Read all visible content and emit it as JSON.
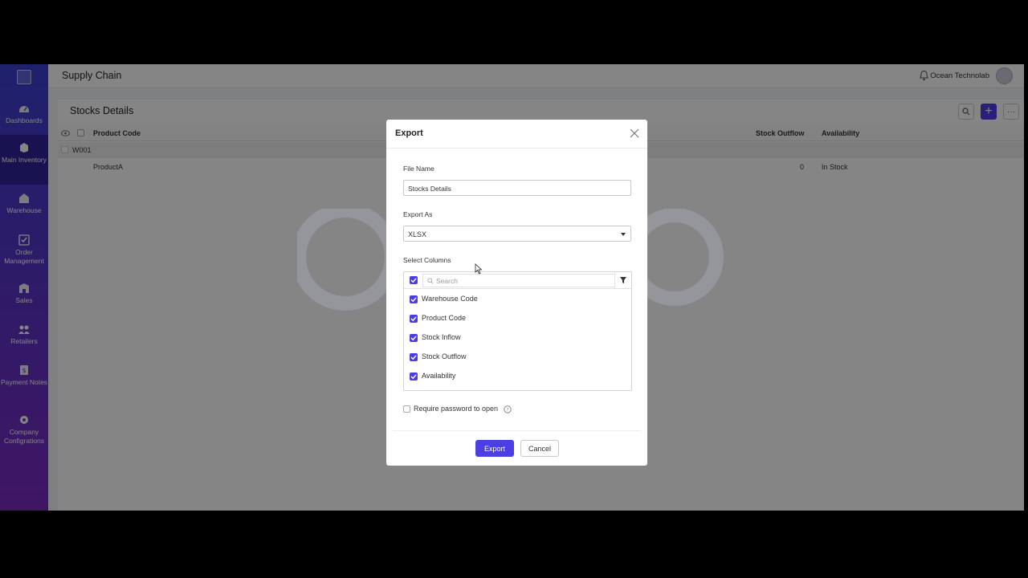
{
  "app": {
    "title": "Supply Chain",
    "org": "Ocean Technolab"
  },
  "sidebar": {
    "items": [
      {
        "label": "Dashboards",
        "icon": "dashboard-icon"
      },
      {
        "label": "Main Inventory",
        "icon": "inventory-box-icon",
        "active": true
      },
      {
        "label": "Warehouse",
        "icon": "warehouse-icon"
      },
      {
        "label": "Order Management",
        "icon": "order-check-icon"
      },
      {
        "label": "Sales",
        "icon": "sales-icon"
      },
      {
        "label": "Retailers",
        "icon": "retailers-icon"
      },
      {
        "label": "Payment Notes",
        "icon": "payment-notes-icon"
      },
      {
        "label": "Company Configrations",
        "icon": "settings-gear-icon"
      }
    ]
  },
  "page": {
    "title": "Stocks Details",
    "columns": [
      "Product Code",
      "Stock Outflow",
      "Availability"
    ],
    "group": "W001",
    "rows": [
      {
        "product_code": "ProductA",
        "stock_outflow": "0",
        "availability": "In Stock"
      }
    ]
  },
  "modal": {
    "title": "Export",
    "file_name_label": "File Name",
    "file_name_value": "Stocks Details",
    "export_as_label": "Export As",
    "export_as_value": "XLSX",
    "select_columns_label": "Select Columns",
    "search_placeholder": "Search",
    "columns": [
      {
        "label": "Warehouse Code",
        "checked": true
      },
      {
        "label": "Product Code",
        "checked": true
      },
      {
        "label": "Stock Inflow",
        "checked": true
      },
      {
        "label": "Stock Outflow",
        "checked": true
      },
      {
        "label": "Availability",
        "checked": true
      }
    ],
    "password_label": "Require password to open",
    "export_button": "Export",
    "cancel_button": "Cancel"
  },
  "colors": {
    "accent": "#4b3ee3",
    "sidebar_top": "#3a3fd0",
    "sidebar_bottom": "#7a2bc0"
  }
}
